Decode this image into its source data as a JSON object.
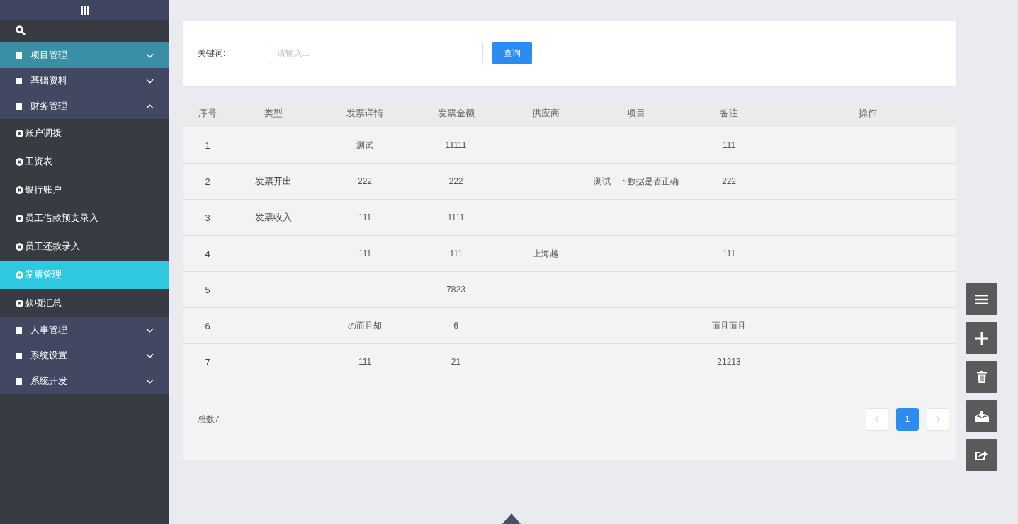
{
  "sidebar": {
    "groups": [
      {
        "label": "项目管理",
        "selected": true,
        "expanded": false
      },
      {
        "label": "基础资料",
        "selected": false,
        "expanded": false
      },
      {
        "label": "财务管理",
        "selected": false,
        "expanded": true,
        "children": [
          {
            "label": "账户调拨",
            "selected": false
          },
          {
            "label": "工资表",
            "selected": false
          },
          {
            "label": "银行账户",
            "selected": false
          },
          {
            "label": "员工借款预支录入",
            "selected": false
          },
          {
            "label": "员工还款录入",
            "selected": false
          },
          {
            "label": "发票管理",
            "selected": true
          },
          {
            "label": "款项汇总",
            "selected": false
          }
        ]
      },
      {
        "label": "人事管理",
        "selected": false,
        "expanded": false
      },
      {
        "label": "系统设置",
        "selected": false,
        "expanded": false
      },
      {
        "label": "系统开发",
        "selected": false,
        "expanded": false
      }
    ]
  },
  "filter": {
    "label": "关键词:",
    "placeholder": "请输入...",
    "button": "查询"
  },
  "table": {
    "columns": [
      "序号",
      "类型",
      "发票详情",
      "发票金额",
      "供应商",
      "项目",
      "备注",
      "操作"
    ],
    "rows": [
      {
        "index": "1",
        "details": "测试",
        "amount": "11111",
        "remark": "111"
      },
      {
        "index": "2",
        "type": "发票开出",
        "details": "222",
        "amount": "222",
        "project": "测试一下数据是否正确",
        "remark": "222"
      },
      {
        "index": "3",
        "type": "发票收入",
        "details": "111",
        "amount": "1111"
      },
      {
        "index": "4",
        "details": "111",
        "amount": "111",
        "supplier": "上海越",
        "remark": "111"
      },
      {
        "index": "5",
        "amount": "7823"
      },
      {
        "index": "6",
        "details": "の而且却",
        "amount": "6",
        "remark": "而且而且"
      },
      {
        "index": "7",
        "details": "111",
        "amount": "21",
        "remark": "21213"
      }
    ]
  },
  "footer": {
    "total": "总数7",
    "pages": [
      {
        "label": "1",
        "selected": true
      }
    ]
  },
  "side_tools": [
    {
      "kind": "menu"
    },
    {
      "kind": "add"
    },
    {
      "kind": "delete"
    },
    {
      "kind": "import"
    },
    {
      "kind": "export"
    }
  ]
}
